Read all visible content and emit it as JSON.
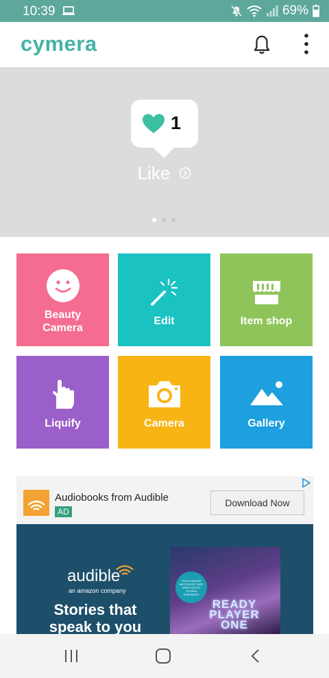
{
  "status_bar": {
    "time": "10:39",
    "battery": "69%",
    "icons": [
      "laptop-icon",
      "mute-icon",
      "wifi-icon",
      "signal-icon",
      "battery-icon"
    ],
    "background": "#5da89b"
  },
  "app_bar": {
    "logo": "cymera",
    "logo_color": "#45b3a5",
    "icons": [
      "bell-icon",
      "more-vert-icon"
    ]
  },
  "banner": {
    "like_count": "1",
    "like_label": "Like",
    "page_count": 3,
    "active_page": 1,
    "heart_color": "#3dbfa3"
  },
  "tiles": [
    {
      "label": "Beauty\nCamera",
      "color": "#f46c8f",
      "icon": "smile-icon"
    },
    {
      "label": "Edit",
      "color": "#1ac2c2",
      "icon": "magic-wand-icon"
    },
    {
      "label": "Item shop",
      "color": "#8fc45a",
      "icon": "store-icon"
    },
    {
      "label": "Liquify",
      "color": "#9b5fc9",
      "icon": "hand-pointer-icon"
    },
    {
      "label": "Camera",
      "color": "#f8b414",
      "icon": "camera-icon"
    },
    {
      "label": "Gallery",
      "color": "#1e9fde",
      "icon": "mountain-icon"
    }
  ],
  "ad": {
    "title": "Audiobooks from Audible",
    "badge": "AD",
    "cta": "Download Now",
    "brand": "audible",
    "brand_sub": "an amazon company",
    "tagline": "Stories that speak to you",
    "poster_title": "READY PLAYER ONE",
    "poster_badge": "NOW A MAJOR MOTION PICTURE DIRECTED BY STEVEN SPIELBERG"
  },
  "nav_bar": {
    "icons": [
      "recent-apps-icon",
      "home-icon",
      "back-icon"
    ]
  }
}
